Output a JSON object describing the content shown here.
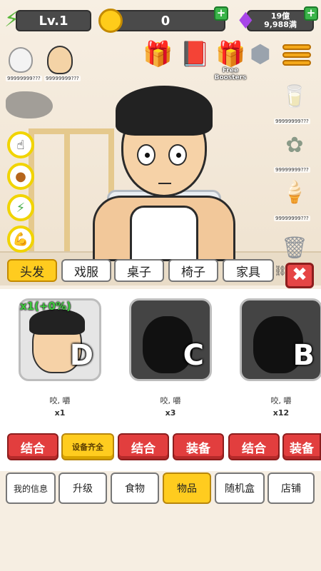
{
  "topbar": {
    "level": "Lv.1",
    "coins": "0",
    "gems_line1": "19億",
    "gems_line2": "9,988满",
    "plus": "+"
  },
  "boosters_label": "Free Boosters",
  "side_labels": {
    "egg": "99999999???",
    "grandpa": "99999999???",
    "milk": "99999999???",
    "flower": "99999999???",
    "icecream": "99999999???"
  },
  "category_tabs": [
    "头发",
    "戏服",
    "桌子",
    "椅子",
    "家具"
  ],
  "close_symbol": "✖",
  "boost_label": "x1(+0%)",
  "cards": [
    {
      "grade": "D",
      "desc": "咬, 嚼",
      "count": "x1"
    },
    {
      "grade": "C",
      "desc": "咬, 嚼",
      "count": "x3"
    },
    {
      "grade": "B",
      "desc": "咬, 嚼",
      "count": "x12"
    }
  ],
  "action_buttons": [
    "结合",
    "设备齐全",
    "结合",
    "装备",
    "结合",
    "装备"
  ],
  "bottom_nav": [
    "我的信息",
    "升级",
    "食物",
    "物品",
    "随机盒",
    "店铺"
  ],
  "icons": {
    "energy": "bolt-icon",
    "coin": "coin-icon",
    "gem": "gem-icon",
    "gift": "gift-icon",
    "book": "book-icon",
    "nut": "nut-icon",
    "menu": "menu-icon"
  },
  "colors": {
    "accent_yellow": "#ffcc1f",
    "button_red": "#e23e3e",
    "boost_green": "#3ec93e"
  }
}
